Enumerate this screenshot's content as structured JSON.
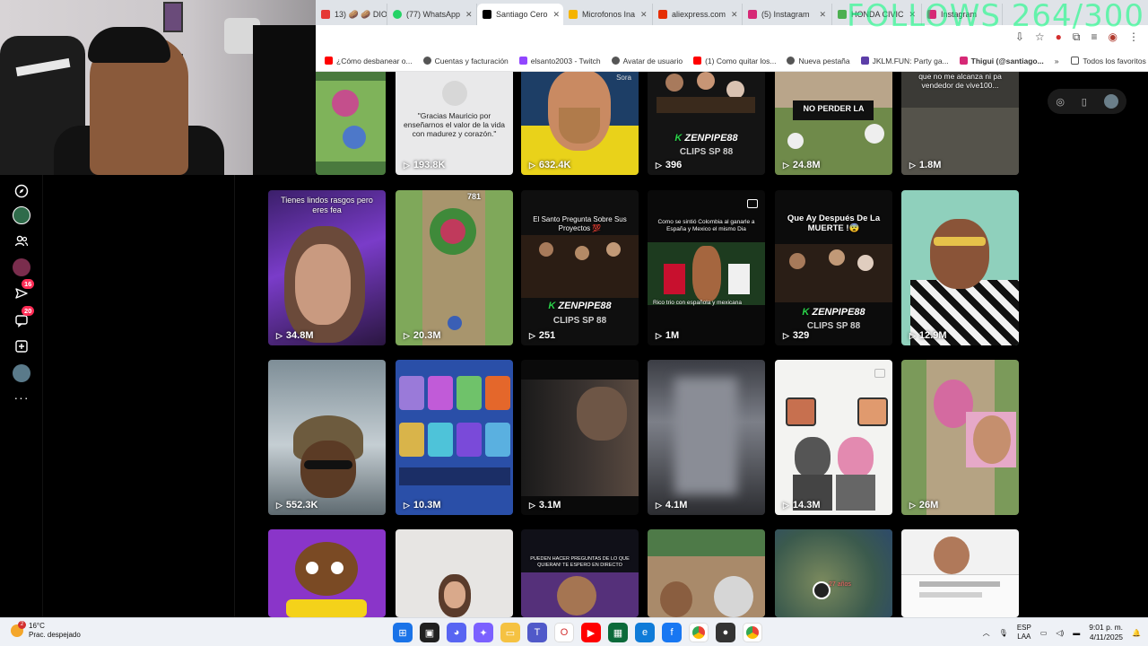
{
  "browser": {
    "tabs": [
      {
        "label": "13) 🥔 🥔 DIO",
        "color": "#e53935"
      },
      {
        "label": "(77) WhatsApp",
        "color": "#25d366"
      },
      {
        "label": "Santiago Cero",
        "color": "#000000",
        "active": true
      },
      {
        "label": "Microfonos Ina",
        "color": "#f5b400"
      },
      {
        "label": "aliexpress.com",
        "color": "#e62e04"
      },
      {
        "label": "(5) Instagram",
        "color": "#d62976"
      },
      {
        "label": "HONDA CIVIC",
        "color": "#4caf50"
      },
      {
        "label": "Instagram",
        "color": "#d62976"
      }
    ],
    "bookmarks": [
      {
        "label": "¿Cómo desbanear o...",
        "color": "#ff0000"
      },
      {
        "label": "Cuentas y facturación",
        "color": "#555555"
      },
      {
        "label": "elsanto2003 - Twitch",
        "color": "#9146ff"
      },
      {
        "label": "Avatar de usuario",
        "color": "#555555"
      },
      {
        "label": "(1) Como quitar los...",
        "color": "#ff0000"
      },
      {
        "label": "Nueva pestaña",
        "color": "#555555"
      },
      {
        "label": "JKLM.FUN: Party ga...",
        "color": "#5c3ea8"
      },
      {
        "label": "Thigui (@santiago...",
        "color": "#d62976"
      }
    ],
    "bookmarks_more": "»",
    "all_favorites": "Todos los favoritos"
  },
  "overlay": {
    "text": "FOLLOWS 264/300"
  },
  "nav": {
    "messages_badge": "16",
    "inbox_badge": "20",
    "more": "···"
  },
  "videos": [
    {
      "views": "193.8K",
      "caption": "\"Gracias Mauricio por enseñarnos el valor de la vida con madurez y corazón.\""
    },
    {
      "views": "632.4K",
      "sora": "Sora"
    },
    {
      "views": "396",
      "zen": "ZENPIPE88",
      "clips": "CLIPS SP 88"
    },
    {
      "views": "24.8M",
      "caption": "NO PERDER LA"
    },
    {
      "views": "1.8M",
      "caption": "que no me alcanza ni pa vendedor de vive100..."
    },
    {
      "views": "34.8M",
      "caption": "Tienes lindos rasgos pero eres fea"
    },
    {
      "views": "20.3M",
      "caption": "781"
    },
    {
      "views": "251",
      "caption": "El Santo Pregunta Sobre Sus Proyectos 💯",
      "zen": "ZENPIPE88",
      "clips": "CLIPS SP 88"
    },
    {
      "views": "1M",
      "caption": "Como se sintió Colombia al ganarle a España y Mexico el mismo Dia",
      "subcaption": "Rico trio con española y mexicana"
    },
    {
      "views": "329",
      "caption": "Que Ay Después De La MUERTE !😨",
      "zen": "ZENPIPE88",
      "clips": "CLIPS SP 88"
    },
    {
      "views": "12.9M"
    },
    {
      "views": "552.3K"
    },
    {
      "views": "10.3M"
    },
    {
      "views": "3.1M"
    },
    {
      "views": "4.1M"
    },
    {
      "views": "14.3M"
    },
    {
      "views": "26M"
    },
    {
      "views": ""
    },
    {
      "views": "",
      "caption": "PUEDEN HACER PREGUNTAS DE LO QUE QUIERAN! TE ESPERO EN DIRECTO"
    },
    {
      "views": ""
    },
    {
      "views": "",
      "caption": "27 años"
    },
    {
      "views": ""
    }
  ],
  "partial_first": {
    "views": ""
  },
  "taskbar": {
    "temperature": "16°C",
    "weather": "Prac. despejado",
    "weather_badge": "2",
    "lang_top": "ESP",
    "lang_bottom": "LAA",
    "time": "9:01 p. m.",
    "date": "4/11/2025"
  }
}
